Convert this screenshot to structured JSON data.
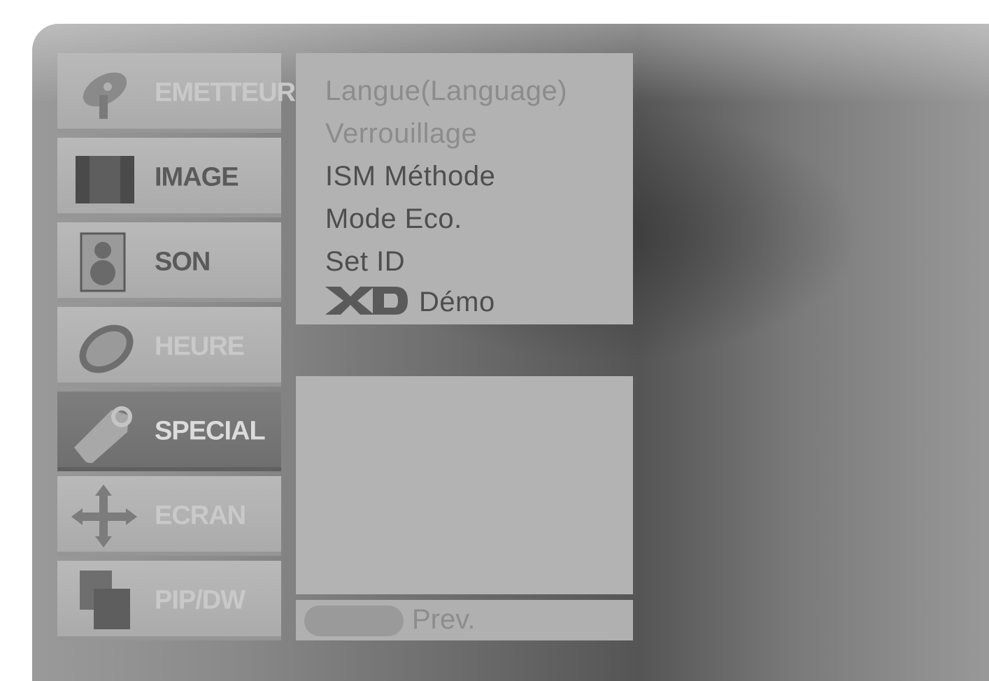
{
  "sidebar": {
    "items": [
      {
        "label": "EMETTEUR",
        "icon": "satellite-dish-icon",
        "state": "dim"
      },
      {
        "label": "IMAGE",
        "icon": "film-icon",
        "state": "normal"
      },
      {
        "label": "SON",
        "icon": "speaker-icon",
        "state": "normal"
      },
      {
        "label": "HEURE",
        "icon": "clock-icon",
        "state": "dim"
      },
      {
        "label": "SPECIAL",
        "icon": "tag-icon",
        "state": "selected"
      },
      {
        "label": "ECRAN",
        "icon": "move-arrows-icon",
        "state": "dim"
      },
      {
        "label": "PIP/DW",
        "icon": "pip-windows-icon",
        "state": "dim"
      }
    ]
  },
  "menu": {
    "items": [
      {
        "label": "Langue(Language)",
        "state": "faded"
      },
      {
        "label": "Verrouillage",
        "state": "faded"
      },
      {
        "label": "ISM Méthode",
        "state": "normal"
      },
      {
        "label": "Mode Eco.",
        "state": "normal"
      },
      {
        "label": "Set ID",
        "state": "normal"
      },
      {
        "label": "Démo",
        "state": "normal",
        "logo": "XD"
      }
    ]
  },
  "footer": {
    "prev_label": "Prev."
  },
  "colors": {
    "panel": "#b2b2b2",
    "selected": "#737373",
    "text": "#4e4e4e"
  }
}
